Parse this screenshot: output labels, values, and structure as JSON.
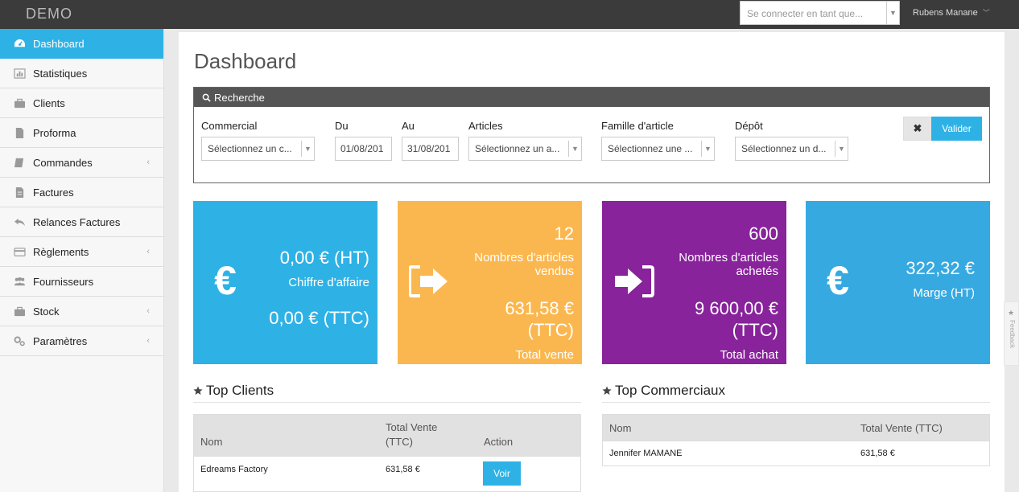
{
  "app": {
    "brand": "DEMO"
  },
  "topbar": {
    "impersonate_placeholder": "Se connecter en tant que...",
    "user_name": "Rubens Manane"
  },
  "sidebar": {
    "items": [
      {
        "label": "Dashboard",
        "icon": "dashboard-icon",
        "active": true
      },
      {
        "label": "Statistiques",
        "icon": "bar-chart-icon"
      },
      {
        "label": "Clients",
        "icon": "briefcase-icon"
      },
      {
        "label": "Proforma",
        "icon": "document-icon"
      },
      {
        "label": "Commandes",
        "icon": "book-icon",
        "expandable": true
      },
      {
        "label": "Factures",
        "icon": "invoice-icon"
      },
      {
        "label": "Relances Factures",
        "icon": "reply-icon"
      },
      {
        "label": "Règlements",
        "icon": "credit-card-icon",
        "expandable": true
      },
      {
        "label": "Fournisseurs",
        "icon": "users-icon"
      },
      {
        "label": "Stock",
        "icon": "box-icon",
        "expandable": true
      },
      {
        "label": "Paramètres",
        "icon": "gears-icon",
        "expandable": true
      }
    ]
  },
  "page": {
    "title": "Dashboard"
  },
  "search": {
    "title": "Recherche",
    "fields": {
      "commercial": {
        "label": "Commercial",
        "value": "Sélectionnez un c..."
      },
      "du": {
        "label": "Du",
        "value": "01/08/201"
      },
      "au": {
        "label": "Au",
        "value": "31/08/201"
      },
      "articles": {
        "label": "Articles",
        "value": "Sélectionnez un a..."
      },
      "famille": {
        "label": "Famille d'article",
        "value": "Sélectionnez une ..."
      },
      "depot": {
        "label": "Dépôt",
        "value": "Sélectionnez un d..."
      }
    },
    "validate_label": "Valider",
    "clear_label": "✖"
  },
  "cards": {
    "ca": {
      "value_ht": "0,00 € (HT)",
      "label": "Chiffre d'affaire",
      "value_ttc": "0,00 € (TTC)",
      "color": "#2eb2e6"
    },
    "ventes": {
      "count": "12",
      "label_line1": "Nombres d'articles",
      "label_line2": "vendus",
      "amount_line1": "631,58 €",
      "amount_line2": "(TTC)",
      "tag": "Total vente",
      "color": "#fbb74f"
    },
    "achats": {
      "count": "600",
      "label_line1": "Nombres d'articles",
      "label_line2": "achetés",
      "amount_line1": "9 600,00 €",
      "amount_line2": "(TTC)",
      "tag": "Total achat",
      "color": "#88239b"
    },
    "marge": {
      "value": "322,32 €",
      "label": "Marge (HT)",
      "color": "#36a9e1"
    }
  },
  "top_clients": {
    "title": "Top Clients",
    "columns": {
      "name": "Nom",
      "total_line1": "Total Vente",
      "total_line2": "(TTC)",
      "action": "Action"
    },
    "rows": [
      {
        "name": "Edreams Factory",
        "total": "631,58 €",
        "action_label": "Voir"
      }
    ]
  },
  "top_commerciaux": {
    "title": "Top Commerciaux",
    "columns": {
      "name": "Nom",
      "total": "Total Vente (TTC)"
    },
    "rows": [
      {
        "name": "Jennifer MAMANE",
        "total": "631,58 €"
      }
    ]
  },
  "feedback": {
    "label": "Feedback"
  }
}
